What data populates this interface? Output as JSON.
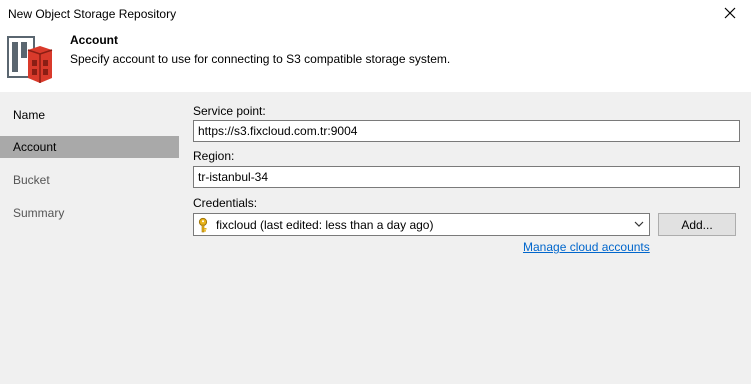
{
  "window": {
    "title": "New Object Storage Repository"
  },
  "header": {
    "title": "Account",
    "description": "Specify account to use for connecting to S3 compatible storage system."
  },
  "sidebar": {
    "items": [
      {
        "label": "Name",
        "state": "completed"
      },
      {
        "label": "Account",
        "state": "active"
      },
      {
        "label": "Bucket",
        "state": "pending"
      },
      {
        "label": "Summary",
        "state": "pending"
      }
    ]
  },
  "form": {
    "service_point": {
      "label": "Service point:",
      "value": "https://s3.fixcloud.com.tr:9004"
    },
    "region": {
      "label": "Region:",
      "value": "tr-istanbul-34"
    },
    "credentials": {
      "label": "Credentials:",
      "selected": "fixcloud (last edited: less than a day ago)",
      "icon": "key-icon"
    },
    "add_button": "Add...",
    "manage_link": "Manage cloud accounts"
  },
  "colors": {
    "active_nav": "#a9a9a9",
    "link": "#0066cc",
    "logo_red": "#d93a2b",
    "logo_gray": "#5a6670"
  }
}
